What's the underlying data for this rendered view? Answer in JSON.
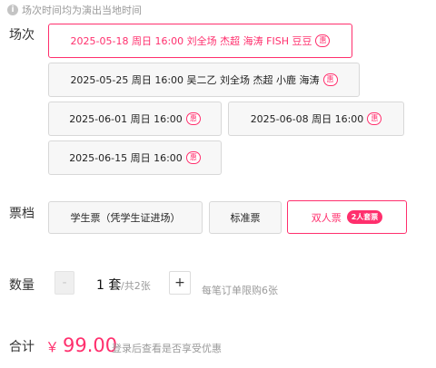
{
  "notice": {
    "icon": "info-icon",
    "text": "场次时间均为演出当地时间"
  },
  "session": {
    "label": "场次",
    "options": [
      {
        "date": "2025-05-18 周日 16:00 刘全场 杰超 海涛 FISH 豆豆",
        "badge": "惠",
        "selected": true
      },
      {
        "date": "2025-05-25 周日 16:00 吴二乙 刘全场 杰超 小鹿 海涛",
        "badge": "惠",
        "selected": false
      },
      {
        "date": "2025-06-01 周日 16:00",
        "badge": "惠",
        "selected": false
      },
      {
        "date": "2025-06-08 周日 16:00",
        "badge": "惠",
        "selected": false
      },
      {
        "date": "2025-06-15 周日 16:00",
        "badge": "惠",
        "selected": false
      }
    ]
  },
  "ticket_tier": {
    "label": "票档",
    "options": [
      {
        "name": "学生票（凭学生证进场）",
        "selected": false
      },
      {
        "name": "标准票",
        "selected": false
      },
      {
        "name": "双人票",
        "promo": "2人套票",
        "selected": true
      }
    ]
  },
  "quantity": {
    "label": "数量",
    "minus": "-",
    "plus": "+",
    "value": "1",
    "unit": "套",
    "total": "/共2张",
    "limit": "每笔订单限购6张"
  },
  "total": {
    "label": "合计",
    "currency": "￥",
    "amount": "99.00",
    "hint": "登录后查看是否享受优惠"
  },
  "colors": {
    "accent": "#ff2f6d",
    "muted": "#9a9a9a",
    "chip_bg": "#f7f7f7",
    "chip_border": "#d8d8d8"
  }
}
